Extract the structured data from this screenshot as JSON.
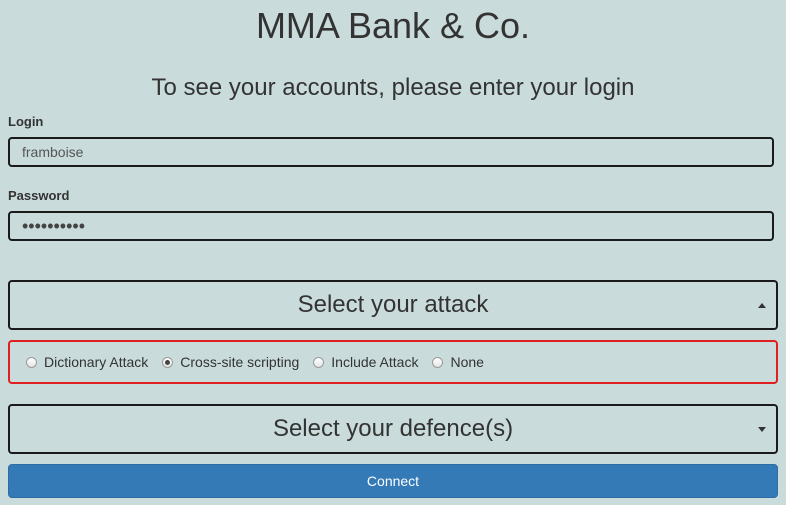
{
  "header": {
    "title": "MMA Bank & Co.",
    "subtitle": "To see your accounts, please enter your login"
  },
  "form": {
    "login_label": "Login",
    "login_value": "framboise",
    "password_label": "Password",
    "password_masked": "••••••••••",
    "attack_select": {
      "label": "Select your attack",
      "state": "expanded",
      "arrow_icon": "caret-up-icon"
    },
    "attack_options": [
      {
        "label": "Dictionary Attack",
        "checked": false
      },
      {
        "label": "Cross-site scripting",
        "checked": true
      },
      {
        "label": "Include Attack",
        "checked": false
      },
      {
        "label": "None",
        "checked": false
      }
    ],
    "defence_select": {
      "label": "Select your defence(s)",
      "state": "collapsed",
      "arrow_icon": "caret-down-icon"
    },
    "connect_label": "Connect"
  },
  "colors": {
    "background": "#c9dcdb",
    "primary_button": "#337ab7",
    "highlight_border": "#e02020"
  }
}
